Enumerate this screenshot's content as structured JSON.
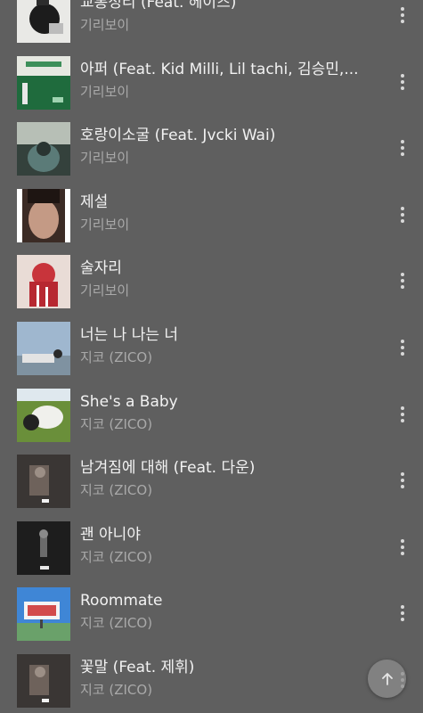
{
  "tracks": [
    {
      "title": "교통정리 (Feat. 헤이즈)",
      "artist": "기리보이",
      "art": "art-1"
    },
    {
      "title": "아퍼 (Feat. Kid Milli, Lil tachi, 김승민,...",
      "artist": "기리보이",
      "art": "art-2"
    },
    {
      "title": "호랑이소굴 (Feat. Jvcki Wai)",
      "artist": "기리보이",
      "art": "art-3"
    },
    {
      "title": "제설",
      "artist": "기리보이",
      "art": "art-4"
    },
    {
      "title": "술자리",
      "artist": "기리보이",
      "art": "art-5"
    },
    {
      "title": "너는 나 나는 너",
      "artist": "지코 (ZICO)",
      "art": "art-6"
    },
    {
      "title": "She's a Baby",
      "artist": "지코 (ZICO)",
      "art": "art-7"
    },
    {
      "title": "남겨짐에 대해 (Feat. 다운)",
      "artist": "지코 (ZICO)",
      "art": "art-8"
    },
    {
      "title": "괜 아니야",
      "artist": "지코 (ZICO)",
      "art": "art-9"
    },
    {
      "title": "Roommate",
      "artist": "지코 (ZICO)",
      "art": "art-10"
    },
    {
      "title": "꽃말 (Feat. 제휘)",
      "artist": "지코 (ZICO)",
      "art": "art-11"
    }
  ],
  "icons": {
    "more": "more-vert-icon",
    "scroll_top": "arrow-up-icon"
  },
  "colors": {
    "background": "#5f5f5f",
    "title_text": "#f2f2f2",
    "artist_text": "#a9a9a9"
  }
}
